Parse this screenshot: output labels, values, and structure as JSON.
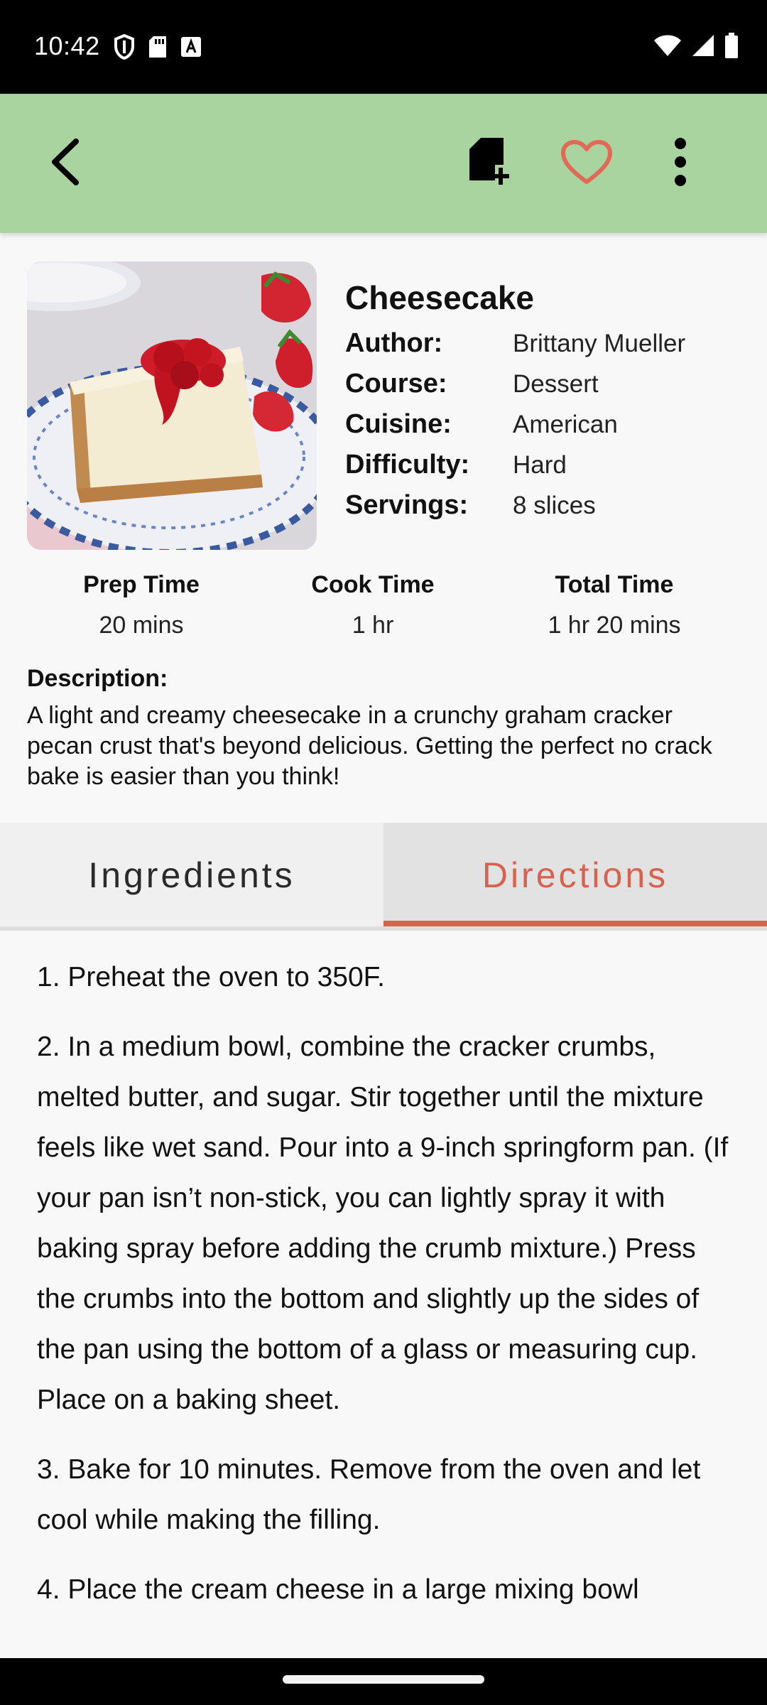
{
  "status_bar": {
    "time": "10:42",
    "left_icons": [
      "shield-icon",
      "sd-card-icon",
      "keyboard-a-icon"
    ],
    "right_icons": [
      "wifi-icon",
      "signal-icon",
      "battery-icon"
    ]
  },
  "app_bar": {
    "color": "#a9d49f",
    "actions": [
      "back-icon",
      "add-to-list-icon",
      "heart-icon",
      "more-vert-icon"
    ],
    "heart_color": "#e06a57"
  },
  "recipe": {
    "title": "Cheesecake",
    "meta": [
      {
        "label": "Author:",
        "value": "Brittany Mueller"
      },
      {
        "label": "Course:",
        "value": "Dessert"
      },
      {
        "label": "Cuisine:",
        "value": "American"
      },
      {
        "label": "Difficulty:",
        "value": "Hard"
      },
      {
        "label": "Servings:",
        "value": "8 slices"
      }
    ],
    "times": [
      {
        "label": "Prep Time",
        "value": "20 mins"
      },
      {
        "label": "Cook Time",
        "value": "1 hr"
      },
      {
        "label": "Total Time",
        "value": "1 hr 20 mins"
      }
    ],
    "description_label": "Description:",
    "description": "A light and creamy cheesecake in a crunchy graham cracker pecan crust that's beyond delicious. Getting the perfect no crack bake is easier than you think!"
  },
  "tabs": {
    "items": [
      {
        "label": "Ingredients",
        "active": false
      },
      {
        "label": "Directions",
        "active": true
      }
    ],
    "accent": "#d9624f"
  },
  "directions": [
    "1.  Preheat the oven to 350F.",
    "2.  In a medium bowl, combine the cracker crumbs, melted butter, and sugar. Stir together until the mixture feels like wet sand. Pour into a 9-inch springform pan. (If your pan isn’t non-stick, you can lightly spray it with baking spray before adding the crumb mixture.) Press the crumbs into the bottom and slightly up the sides of the pan using the bottom of a glass or measuring cup. Place on a baking sheet.",
    "3.  Bake for 10 minutes. Remove from the oven and let cool while making the filling.",
    "4.  Place the cream cheese in a large mixing bowl"
  ]
}
